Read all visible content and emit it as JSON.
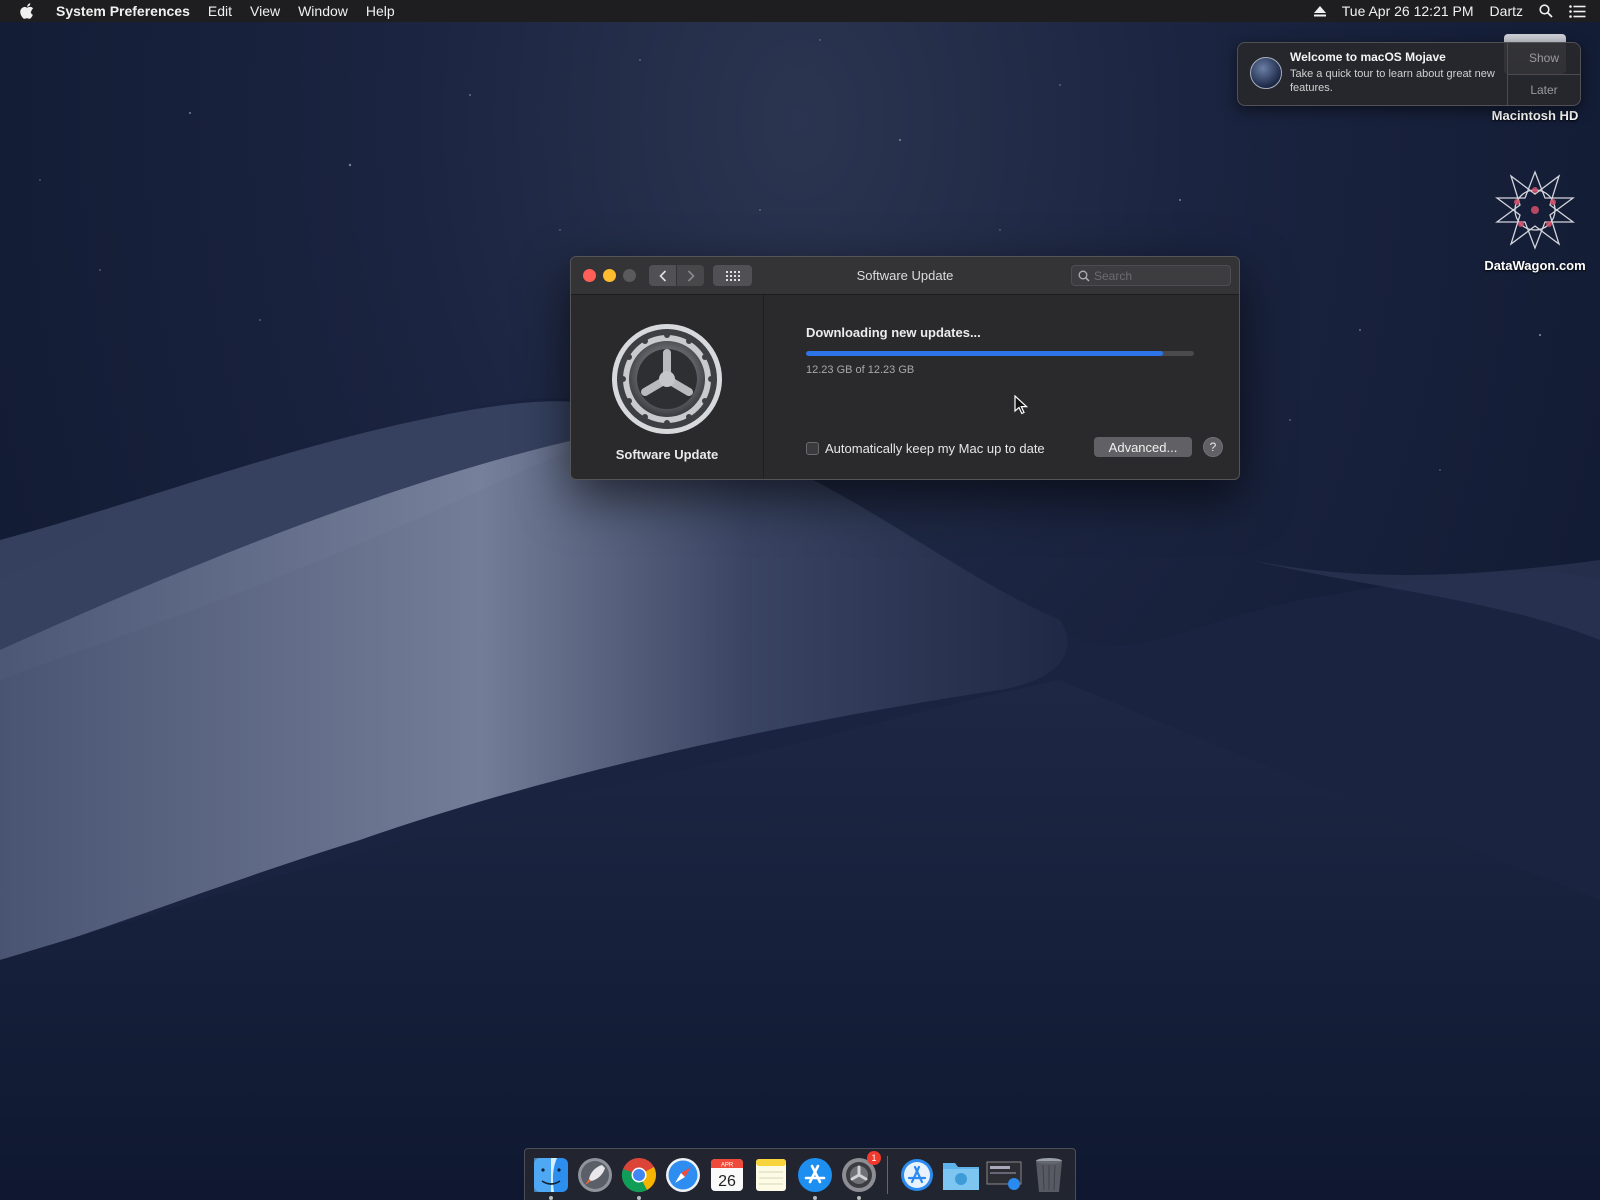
{
  "menubar": {
    "app_name": "System Preferences",
    "menus": [
      "Edit",
      "View",
      "Window",
      "Help"
    ],
    "datetime": "Tue Apr 26  12:21 PM",
    "user": "Dartz"
  },
  "notification": {
    "title": "Welcome to macOS Mojave",
    "body": "Take a quick tour to learn about great new features.",
    "show_label": "Show",
    "later_label": "Later"
  },
  "desktop": {
    "icons": [
      {
        "label": "Macintosh HD"
      },
      {
        "label": "DataWagon.com"
      }
    ]
  },
  "window": {
    "title": "Software Update",
    "search_placeholder": "Search",
    "sidebar_label": "Software Update",
    "status": "Downloading new updates...",
    "progress_fraction": 0.92,
    "size_text": "12.23 GB of 12.23 GB",
    "auto_update_label": "Automatically keep my Mac up to date",
    "auto_update_checked": false,
    "advanced_label": "Advanced...",
    "help_label": "?"
  },
  "dock": {
    "items": [
      "finder",
      "launchpad",
      "chrome",
      "safari",
      "calendar",
      "notes",
      "app-store",
      "system-preferences",
      "appstore-folder",
      "downloads-folder",
      "screenshot-app",
      "trash"
    ],
    "calendar": {
      "month": "APR",
      "day": "26"
    },
    "system_preferences_badge": "1"
  },
  "colors": {
    "accent": "#2c74e8",
    "close": "#fe5f57",
    "minimize": "#febc2e"
  }
}
